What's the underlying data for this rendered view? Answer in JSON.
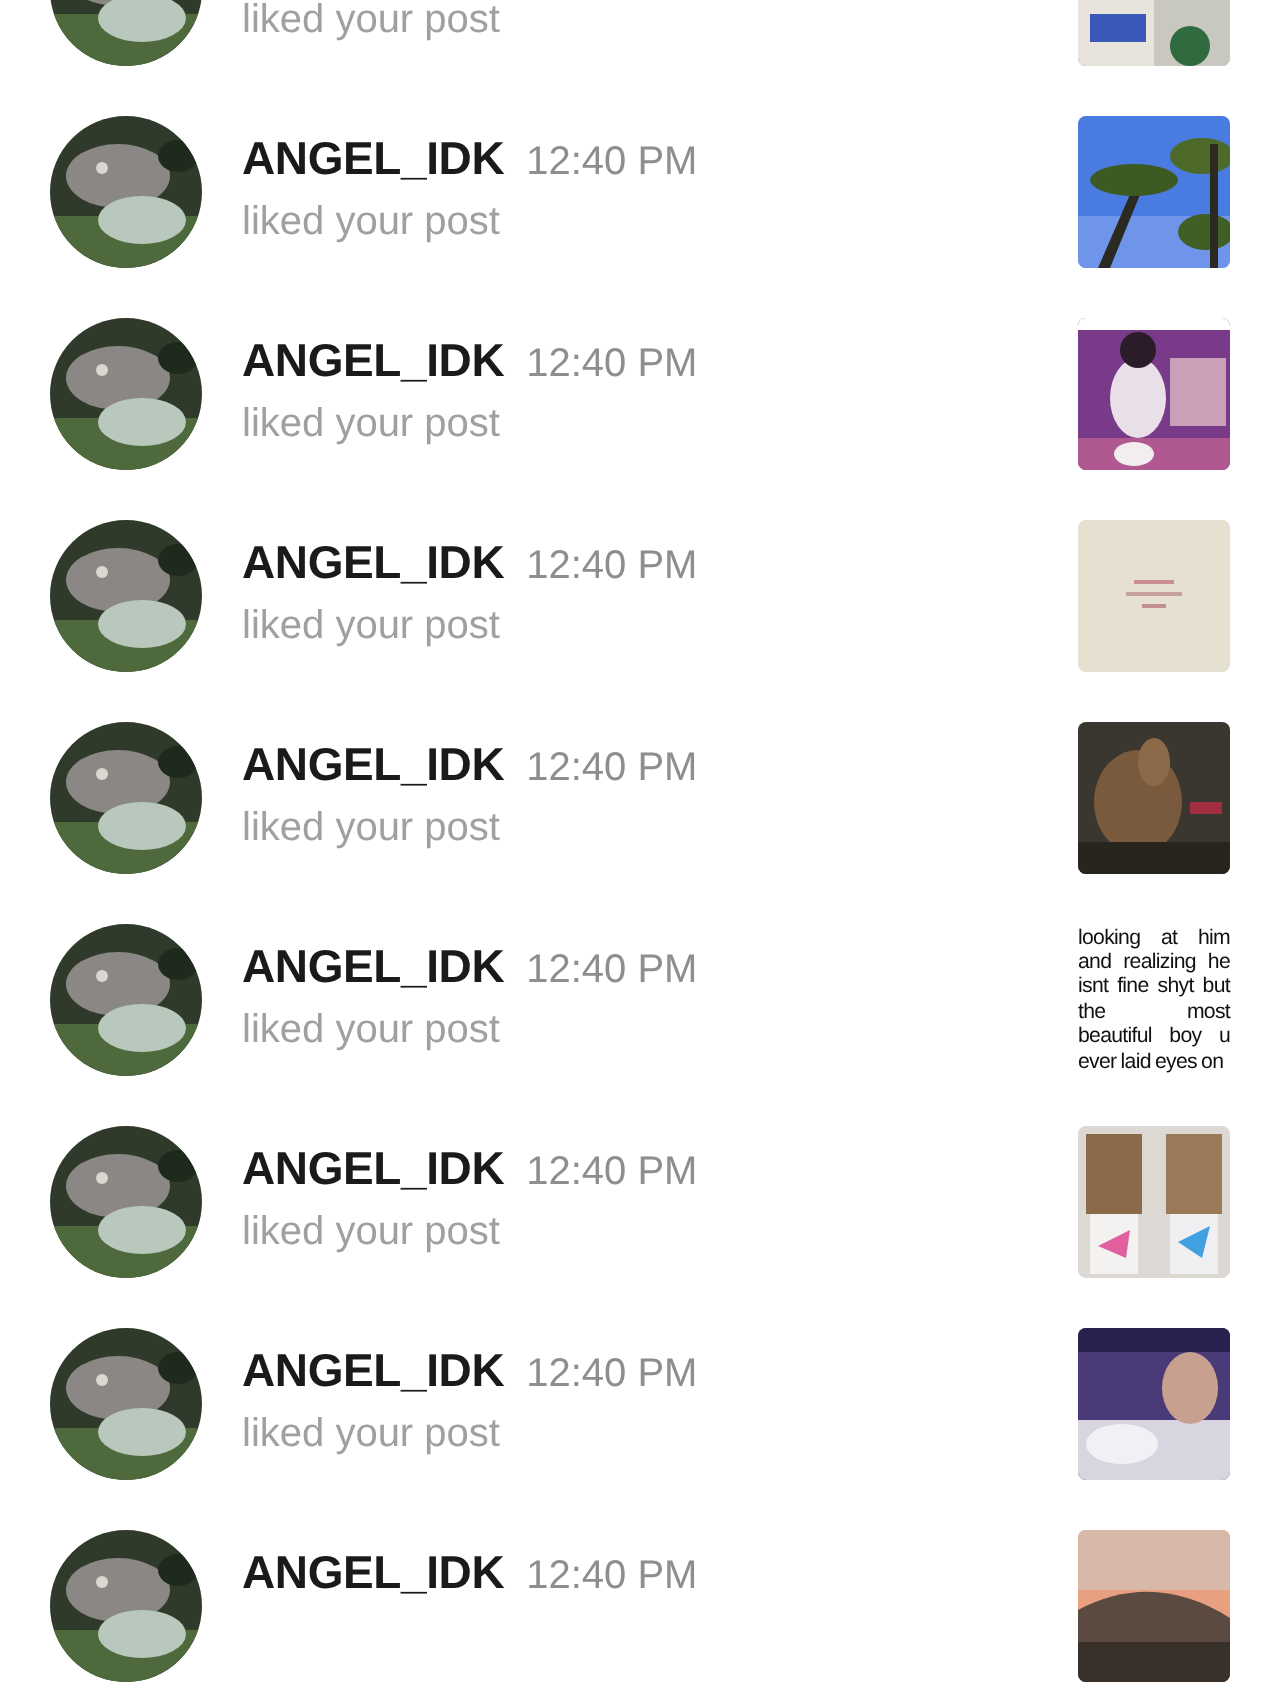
{
  "notifications": [
    {
      "action": "liked your post"
    },
    {
      "name": "ANGEL_IDK",
      "time": "12:40 PM",
      "action": "liked your post"
    },
    {
      "name": "ANGEL_IDK",
      "time": "12:40 PM",
      "action": "liked your post"
    },
    {
      "name": "ANGEL_IDK",
      "time": "12:40 PM",
      "action": "liked your post"
    },
    {
      "name": "ANGEL_IDK",
      "time": "12:40 PM",
      "action": "liked your post"
    },
    {
      "name": "ANGEL_IDK",
      "time": "12:40 PM",
      "action": "liked your post",
      "thumbnail": {
        "kind": "text",
        "text": "looking at him and realizing he isnt fine shyt but the most beautiful boy u ever laid eyes on"
      }
    },
    {
      "name": "ANGEL_IDK",
      "time": "12:40 PM",
      "action": "liked your post"
    },
    {
      "name": "ANGEL_IDK",
      "time": "12:40 PM",
      "action": "liked your post"
    },
    {
      "name": "ANGEL_IDK",
      "time": "12:40 PM"
    }
  ]
}
